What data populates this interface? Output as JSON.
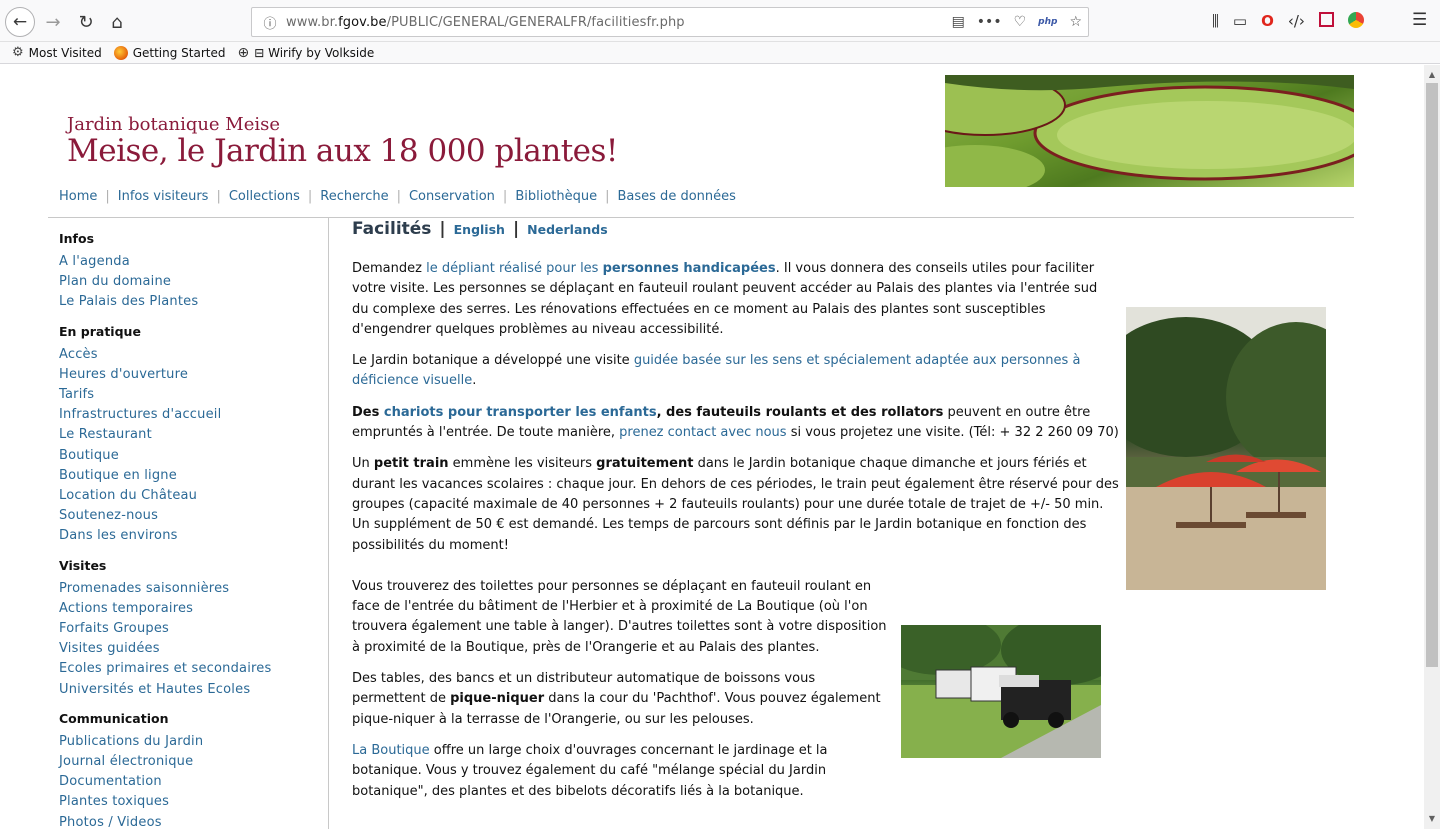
{
  "browser": {
    "url_prefix": "www.br.",
    "url_domain": "fgov.be",
    "url_path": "/PUBLIC/GENERAL/GENERALFR/facilitiesfr.php",
    "php_badge": "php",
    "bookmarks": [
      "Most Visited",
      "Getting Started",
      "⊟ Wirify by Volkside"
    ]
  },
  "header": {
    "subtitle": "Jardin botanique Meise",
    "title": "Meise, le Jardin aux 18 000 plantes!"
  },
  "topnav": [
    "Home",
    "Infos visiteurs",
    "Collections",
    "Recherche",
    "Conservation",
    "Bibliothèque",
    "Bases de données"
  ],
  "sidebar": {
    "sections": [
      {
        "title": "Infos",
        "items": [
          "A l'agenda",
          "Plan du domaine",
          "Le Palais des Plantes"
        ]
      },
      {
        "title": "En pratique",
        "items": [
          "Accès",
          "Heures d'ouverture",
          "Tarifs",
          "Infrastructures d'accueil",
          "Le Restaurant",
          "Boutique",
          "Boutique en ligne",
          "Location du Château",
          "Soutenez-nous",
          "Dans les environs"
        ]
      },
      {
        "title": "Visites",
        "items": [
          "Promenades saisonnières",
          "Actions temporaires",
          "Forfaits Groupes",
          "Visites guidées",
          "Ecoles primaires et secondaires",
          "Universités et Hautes Ecoles"
        ]
      },
      {
        "title": "Communication",
        "items": [
          "Publications du Jardin",
          "Journal électronique",
          "Documentation",
          "Plantes toxiques",
          "Photos / Videos"
        ]
      }
    ]
  },
  "content": {
    "heading": "Facilités",
    "lang_en": "English",
    "lang_nl": "Nederlands",
    "p1": {
      "pre": "Demandez ",
      "link": "le dépliant réalisé pour les ",
      "link_bold": "personnes handicapées",
      "post": ". Il vous donnera des conseils utiles pour faciliter votre visite. Les personnes se déplaçant en fauteuil roulant peuvent accéder au Palais des plantes via l'entrée sud du complexe des serres. Les rénovations effectuées en ce moment au Palais des plantes sont susceptibles d'engendrer quelques problèmes au niveau accessibilité."
    },
    "p2": {
      "pre": "Le Jardin botanique a développé une visite ",
      "link": "guidée basée sur les sens et spécialement adaptée aux personnes à déficience visuelle",
      "post": "."
    },
    "p3": {
      "b1": "Des ",
      "link": "chariots pour transporter les enfants",
      "b2": ", des fauteuils roulants et des rollators",
      "mid": " peuvent en outre être empruntés à l'entrée. De toute manière, ",
      "link2": "prenez contact avec nous",
      "post": " si vous projetez une visite. (Tél: + 32 2 260 09 70)"
    },
    "p4": {
      "pre": "Un ",
      "b1": "petit train",
      "mid": " emmène les visiteurs ",
      "b2": "gratuitement",
      "post": " dans le Jardin botanique chaque dimanche et jours fériés et durant les vacances scolaires : chaque jour. En dehors de ces périodes, le train peut également être réservé pour des groupes (capacité maximale de 40 personnes + 2 fauteuils roulants) pour une durée totale de trajet de +/- 50 min. Un supplément de 50 € est demandé. Les temps de parcours sont définis par le Jardin botanique en fonction des possibilités du moment!"
    },
    "p5": "Vous trouverez des toilettes pour personnes se déplaçant en fauteuil roulant en face de l'entrée du bâtiment de l'Herbier et à proximité de La Boutique (où l'on trouvera également une table à langer). D'autres toilettes sont à votre disposition à proximité de la Boutique, près de l'Orangerie et au Palais des plantes.",
    "p6": {
      "pre": "Des tables, des bancs et un distributeur automatique de boissons vous permettent de ",
      "b": "pique-niquer",
      "post": " dans la cour du 'Pachthof'. Vous pouvez également pique-niquer à la terrasse de l'Orangerie, ou sur les pelouses."
    },
    "p7": {
      "link": "La Boutique",
      "post": " offre un large choix d'ouvrages concernant le jardinage et la botanique. Vous y trouvez également du café \"mélange spécial du Jardin botanique\", des plantes et des bibelots décoratifs liés à la botanique."
    }
  }
}
